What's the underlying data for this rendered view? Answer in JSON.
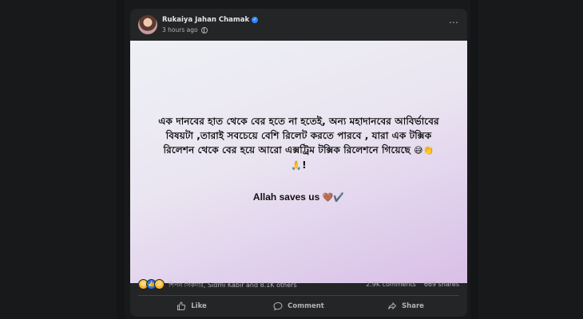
{
  "post": {
    "author": "Rukaiya Jahan Chamak",
    "timestamp": "3 hours ago",
    "text": "এক দানবের হাত থেকে বের হতে না হতেই, অন্য মহাদানবের আবির্ভাবের বিষয়টা ,তারাই সবচেয়ে বেশি রিলেট করতে পারবে , যারা এক টক্সিক রিলেশন থেকে বের হয়ে আরো এক্সট্রিম টক্সিক রিলেশনে গিয়েছে",
    "text_emoji": "😅👏",
    "text_end_emoji": "🙏",
    "text_end": "!",
    "tagline": "Allah saves us",
    "tagline_emoji": "🤎✔️",
    "more_icon": "⋯"
  },
  "stats": {
    "reaction_emojis": [
      "😆",
      "👍",
      "😢"
    ],
    "reactors": "শিপন সিকদার, Sidmi Kabir and 8.1K others",
    "comments": "2.9K comments",
    "shares": "669 shares"
  },
  "actions": {
    "like": "Like",
    "comment": "Comment",
    "share": "Share"
  },
  "colors": {
    "card_bg": "#242526",
    "page_bg": "#18191a",
    "muted_text": "#b0b3b8",
    "verified_blue": "#2d88ff"
  }
}
